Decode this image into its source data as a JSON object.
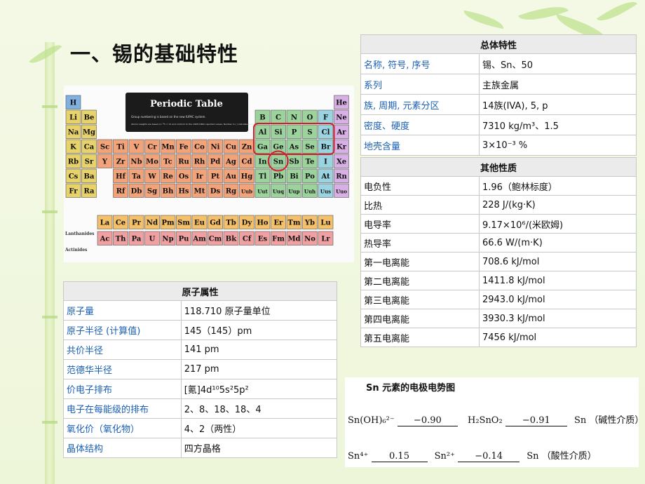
{
  "title": "一、锡的基础特性",
  "general": {
    "header": "总体特性",
    "rows": [
      {
        "label": "名称, 符号, 序号",
        "value": "锡、Sn、50"
      },
      {
        "label": "系列",
        "value": "主族金属"
      },
      {
        "label": "族, 周期, 元素分区",
        "value": "14族(IVA), 5, p"
      },
      {
        "label": "密度、硬度",
        "value": "7310 kg/m³、1.5"
      },
      {
        "label": "地壳含量",
        "value": "3×10⁻³ %"
      }
    ]
  },
  "other": {
    "header": "其他性质",
    "rows": [
      {
        "label": "电负性",
        "value": "1.96（鲍林标度）"
      },
      {
        "label": "比热",
        "value": "228 J/(kg·K)"
      },
      {
        "label": "电导率",
        "value": "9.17×10⁶/(米欧姆)"
      },
      {
        "label": "热导率",
        "value": "66.6 W/(m·K)"
      },
      {
        "label": "第一电离能",
        "value": "708.6 kJ/mol"
      },
      {
        "label": "第二电离能",
        "value": "1411.8 kJ/mol"
      },
      {
        "label": "第三电离能",
        "value": "2943.0 kJ/mol"
      },
      {
        "label": "第四电离能",
        "value": "3930.3 kJ/mol"
      },
      {
        "label": "第五电离能",
        "value": "7456 kJ/mol"
      }
    ]
  },
  "atomic": {
    "header": "原子属性",
    "rows": [
      {
        "label": "原子量",
        "value": "118.710 原子量单位"
      },
      {
        "label": "原子半径 (计算值)",
        "value": "145（145）pm"
      },
      {
        "label": "共价半径",
        "value": "141 pm"
      },
      {
        "label": "范德华半径",
        "value": "217 pm"
      },
      {
        "label": "价电子排布",
        "value": "[氪]4d¹⁰5s²5p²"
      },
      {
        "label": "电子在每能级的排布",
        "value": "2、8、18、18、4"
      },
      {
        "label": "氧化价（氧化物）",
        "value": "4、2（两性）"
      },
      {
        "label": "晶体结构",
        "value": "四方晶格"
      }
    ]
  },
  "periodic_table": {
    "heading": "Periodic Table",
    "note1": "Group numbering is based on the new IUPAC system.",
    "note2": "Atomic weights are based on ¹²C = 12 and conform to the 1995 IUPAC reported values. Number in ( ) indicates the isotope of longest half life.",
    "lanthanides": "Lanthanides",
    "actinides": "Actinides",
    "highlighted": "Sn",
    "rows": [
      [
        "H",
        "",
        "",
        "",
        "",
        "",
        "",
        "",
        "",
        "",
        "",
        "",
        "",
        "",
        "",
        "",
        "",
        "He"
      ],
      [
        "Li",
        "Be",
        "",
        "",
        "",
        "",
        "",
        "",
        "",
        "",
        "",
        "",
        "B",
        "C",
        "N",
        "O",
        "F",
        "Ne"
      ],
      [
        "Na",
        "Mg",
        "",
        "",
        "",
        "",
        "",
        "",
        "",
        "",
        "",
        "",
        "Al",
        "Si",
        "P",
        "S",
        "Cl",
        "Ar"
      ],
      [
        "K",
        "Ca",
        "Sc",
        "Ti",
        "V",
        "Cr",
        "Mn",
        "Fe",
        "Co",
        "Ni",
        "Cu",
        "Zn",
        "Ga",
        "Ge",
        "As",
        "Se",
        "Br",
        "Kr"
      ],
      [
        "Rb",
        "Sr",
        "Y",
        "Zr",
        "Nb",
        "Mo",
        "Tc",
        "Ru",
        "Rh",
        "Pd",
        "Ag",
        "Cd",
        "In",
        "Sn",
        "Sb",
        "Te",
        "I",
        "Xe"
      ],
      [
        "Cs",
        "Ba",
        "",
        "Hf",
        "Ta",
        "W",
        "Re",
        "Os",
        "Ir",
        "Pt",
        "Au",
        "Hg",
        "Tl",
        "Pb",
        "Bi",
        "Po",
        "At",
        "Rn"
      ],
      [
        "Fr",
        "Ra",
        "",
        "Rf",
        "Db",
        "Sg",
        "Bh",
        "Hs",
        "Mt",
        "Ds",
        "Rg",
        "Uub",
        "Uut",
        "Uuq",
        "Uup",
        "Uuh",
        "Uus",
        "Uuo"
      ]
    ],
    "lan": [
      "La",
      "Ce",
      "Pr",
      "Nd",
      "Pm",
      "Sm",
      "Eu",
      "Gd",
      "Tb",
      "Dy",
      "Ho",
      "Er",
      "Tm",
      "Yb",
      "Lu"
    ],
    "act": [
      "Ac",
      "Th",
      "Pa",
      "U",
      "Np",
      "Pu",
      "Am",
      "Cm",
      "Bk",
      "Cf",
      "Es",
      "Fm",
      "Md",
      "No",
      "Lr"
    ]
  },
  "electrode": {
    "heading": "Sn 元素的电极电势图",
    "basic": {
      "s1": "Sn(OH)₆²⁻",
      "v1": "−0.90",
      "s2": "H₂SnO₂",
      "v2": "−0.91",
      "s3": "Sn",
      "medium": "（碱性介质）"
    },
    "acid": {
      "s1": "Sn⁴⁺",
      "v1": "0.15",
      "s2": "Sn²⁺",
      "v2": "−0.14",
      "s3": "Sn",
      "medium": "（酸性介质）"
    }
  }
}
